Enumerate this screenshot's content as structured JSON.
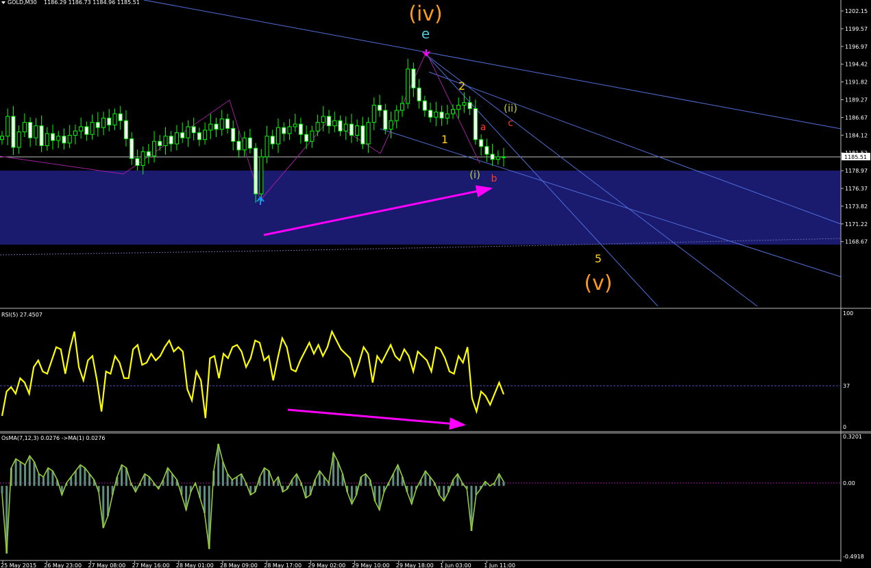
{
  "header": {
    "symbol": "GOLD,M30",
    "ohlc": "1186.29 1186.73 1184.96 1185.51"
  },
  "price_axis": {
    "ticks": [
      "1202.15",
      "1199.57",
      "1196.97",
      "1194.42",
      "1191.82",
      "1189.27",
      "1186.67",
      "1184.12",
      "1181.52",
      "1178.97",
      "1176.37",
      "1173.82",
      "1171.22",
      "1168.67"
    ],
    "current": "1185.51"
  },
  "time_axis": [
    "25 May 2015",
    "26 May 23:00",
    "27 May 08:00",
    "27 May 16:00",
    "28 May 01:00",
    "28 May 09:00",
    "28 May 17:00",
    "29 May 02:00",
    "29 May 10:00",
    "29 May 18:00",
    "1 Jun 03:00",
    "1 Jun 11:00"
  ],
  "wave_labels": {
    "iv": "(iv)",
    "e": "e",
    "two": "2",
    "one": "1",
    "ii": "(ii)",
    "a": "a",
    "c": "c",
    "i": "(i)",
    "b": "b",
    "five": "5",
    "v": "(v)"
  },
  "rsi": {
    "label": "RSI(5) 27.4507",
    "ticks": [
      "100",
      "37",
      "0"
    ]
  },
  "osma": {
    "label": "OsMA(7,12,3) 0.0276  ->MA(1) 0.0276",
    "ticks": [
      "0.3201",
      "0.00",
      "-0.4918"
    ]
  },
  "colors": {
    "background": "#000000",
    "candle": "#00ff00",
    "zone": "#1a1a6e",
    "trendline": "#4f6fd8",
    "arrow": "#ff00ff",
    "rsi": "#ffff00",
    "osma_line": "#9acd32",
    "osma_hist": "#5f8f7f",
    "wave_orange": "#ff9a1a",
    "wave_yellow": "#ffd21a",
    "wave_red": "#ff3a2a",
    "wave_olive": "#b5c93a",
    "wave_cyan": "#4fc8d8"
  },
  "chart_data": [
    {
      "type": "candlestick",
      "title": "GOLD,M30",
      "ylim": [
        1168.0,
        1203.5
      ],
      "close": [
        1188.0,
        1190.3,
        1186.7,
        1188.5,
        1189.6,
        1187.8,
        1189.2,
        1186.9,
        1188.3,
        1187.5,
        1188.0,
        1187.2,
        1188.1,
        1188.6,
        1189.1,
        1188.2,
        1189.6,
        1189.0,
        1190.1,
        1189.3,
        1190.6,
        1189.8,
        1187.7,
        1185.4,
        1184.6,
        1186.2,
        1185.7,
        1187.4,
        1186.9,
        1188.0,
        1187.1,
        1188.4,
        1187.8,
        1189.1,
        1188.4,
        1187.6,
        1188.7,
        1189.4,
        1188.8,
        1190.0,
        1188.9,
        1187.4,
        1186.4,
        1187.8,
        1186.6,
        1181.3,
        1185.6,
        1188.0,
        1187.1,
        1189.0,
        1188.3,
        1189.1,
        1189.4,
        1188.2,
        1187.4,
        1188.6,
        1189.6,
        1190.3,
        1189.2,
        1189.8,
        1188.6,
        1189.4,
        1188.1,
        1189.2,
        1187.1,
        1189.6,
        1191.6,
        1191.0,
        1188.8,
        1189.8,
        1191.0,
        1191.8,
        1195.8,
        1193.6,
        1192.1,
        1191.0,
        1190.2,
        1190.8,
        1190.1,
        1190.6,
        1191.1,
        1191.6,
        1191.9,
        1191.2,
        1187.6,
        1186.8,
        1185.9,
        1185.3,
        1185.6,
        1185.51
      ],
      "series": [
        {
          "name": "GOLD,M30"
        }
      ]
    },
    {
      "type": "line",
      "title": "RSI(5) 27.4507",
      "ylim": [
        0,
        100
      ],
      "levels": [
        37
      ],
      "values": [
        8,
        30,
        34,
        28,
        42,
        38,
        28,
        52,
        58,
        48,
        46,
        58,
        70,
        68,
        46,
        68,
        84,
        52,
        40,
        58,
        62,
        40,
        12,
        48,
        46,
        62,
        56,
        42,
        42,
        68,
        72,
        54,
        56,
        64,
        58,
        62,
        70,
        76,
        66,
        70,
        66,
        32,
        22,
        48,
        40,
        6,
        60,
        62,
        42,
        64,
        60,
        70,
        72,
        66,
        52,
        60,
        76,
        74,
        58,
        62,
        40,
        60,
        78,
        70,
        50,
        48,
        58,
        66,
        74,
        64,
        72,
        62,
        70,
        84,
        76,
        68,
        64,
        60,
        44,
        56,
        70,
        64,
        38,
        62,
        56,
        64,
        72,
        62,
        58,
        68,
        62,
        48,
        66,
        62,
        58,
        48,
        70,
        68,
        60,
        48,
        46,
        62,
        56,
        70,
        24,
        12,
        30,
        26,
        18,
        28,
        38,
        27.45
      ]
    },
    {
      "type": "area",
      "title": "OsMA(7,12,3) 0.0276  ->MA(1) 0.0276",
      "ylim": [
        -0.4918,
        0.3201
      ],
      "values": [
        -0.05,
        -0.45,
        0.12,
        0.18,
        0.16,
        0.14,
        0.2,
        0.16,
        0.08,
        0.06,
        0.12,
        0.1,
        0.04,
        -0.06,
        0.02,
        0.06,
        0.1,
        0.14,
        0.12,
        0.08,
        0.04,
        -0.04,
        -0.28,
        -0.2,
        -0.06,
        0.06,
        0.14,
        0.12,
        0.02,
        -0.04,
        0.02,
        0.08,
        0.06,
        0.02,
        -0.02,
        0.04,
        0.12,
        0.08,
        0.04,
        -0.06,
        -0.16,
        -0.04,
        0.02,
        -0.08,
        -0.18,
        -0.42,
        0.1,
        0.28,
        0.16,
        0.08,
        0.04,
        0.06,
        0.08,
        0.02,
        -0.06,
        -0.04,
        0.06,
        0.12,
        0.1,
        0.02,
        0.06,
        -0.04,
        -0.02,
        0.04,
        0.08,
        0.02,
        -0.08,
        -0.06,
        0.04,
        0.1,
        0.06,
        0.02,
        0.22,
        0.16,
        0.08,
        -0.04,
        -0.12,
        -0.06,
        0.06,
        0.08,
        0.04,
        -0.1,
        -0.16,
        -0.04,
        0.02,
        0.08,
        0.14,
        0.06,
        -0.04,
        -0.12,
        -0.02,
        0.04,
        0.1,
        0.06,
        0.02,
        -0.06,
        -0.1,
        -0.04,
        0.04,
        0.08,
        0.02,
        -0.02,
        -0.3,
        -0.06,
        -0.02,
        0.03,
        0.0,
        0.02,
        0.08,
        0.0276
      ]
    }
  ]
}
